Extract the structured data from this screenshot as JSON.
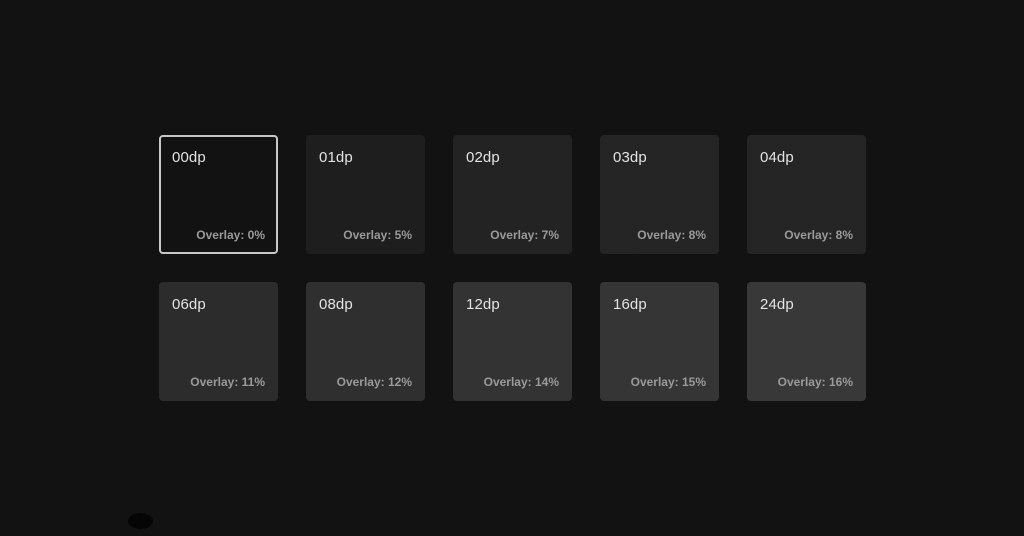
{
  "surfaces": [
    {
      "title": "00dp",
      "overlay_label": "Overlay: 0%",
      "overlay": 0.0,
      "selected": true
    },
    {
      "title": "01dp",
      "overlay_label": "Overlay: 5%",
      "overlay": 0.05,
      "selected": false
    },
    {
      "title": "02dp",
      "overlay_label": "Overlay: 7%",
      "overlay": 0.07,
      "selected": false
    },
    {
      "title": "03dp",
      "overlay_label": "Overlay: 8%",
      "overlay": 0.08,
      "selected": false
    },
    {
      "title": "04dp",
      "overlay_label": "Overlay: 8%",
      "overlay": 0.08,
      "selected": false
    },
    {
      "title": "06dp",
      "overlay_label": "Overlay: 11%",
      "overlay": 0.11,
      "selected": false
    },
    {
      "title": "08dp",
      "overlay_label": "Overlay: 12%",
      "overlay": 0.12,
      "selected": false
    },
    {
      "title": "12dp",
      "overlay_label": "Overlay: 14%",
      "overlay": 0.14,
      "selected": false
    },
    {
      "title": "16dp",
      "overlay_label": "Overlay: 15%",
      "overlay": 0.15,
      "selected": false
    },
    {
      "title": "24dp",
      "overlay_label": "Overlay: 16%",
      "overlay": 0.16,
      "selected": false
    }
  ],
  "colors": {
    "background": "#121212",
    "overlay": "#ffffff",
    "selected_border": "#c8c8c8",
    "title_text": "#e3e3e3",
    "overlay_text": "#9a9a9a"
  }
}
